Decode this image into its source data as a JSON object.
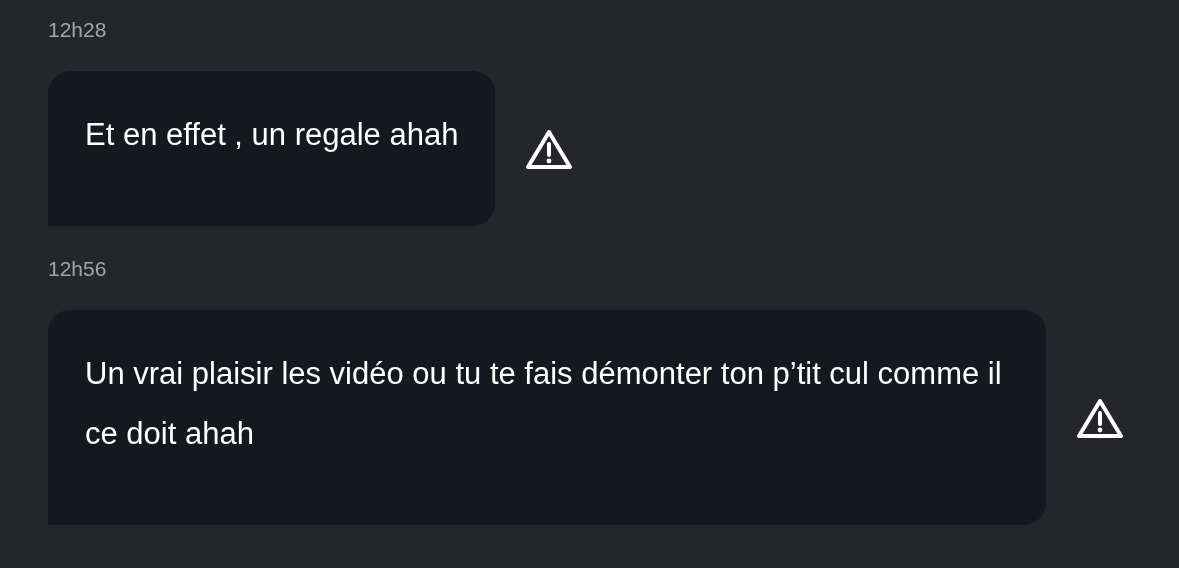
{
  "messages": [
    {
      "time": "12h28",
      "text": "Et en effet , un regale ahah",
      "flagged": true
    },
    {
      "time": "12h56",
      "text": "Un vrai plaisir les vidéo ou tu te fais démonter ton p’tit cul comme il ce doit ahah",
      "flagged": true
    }
  ]
}
